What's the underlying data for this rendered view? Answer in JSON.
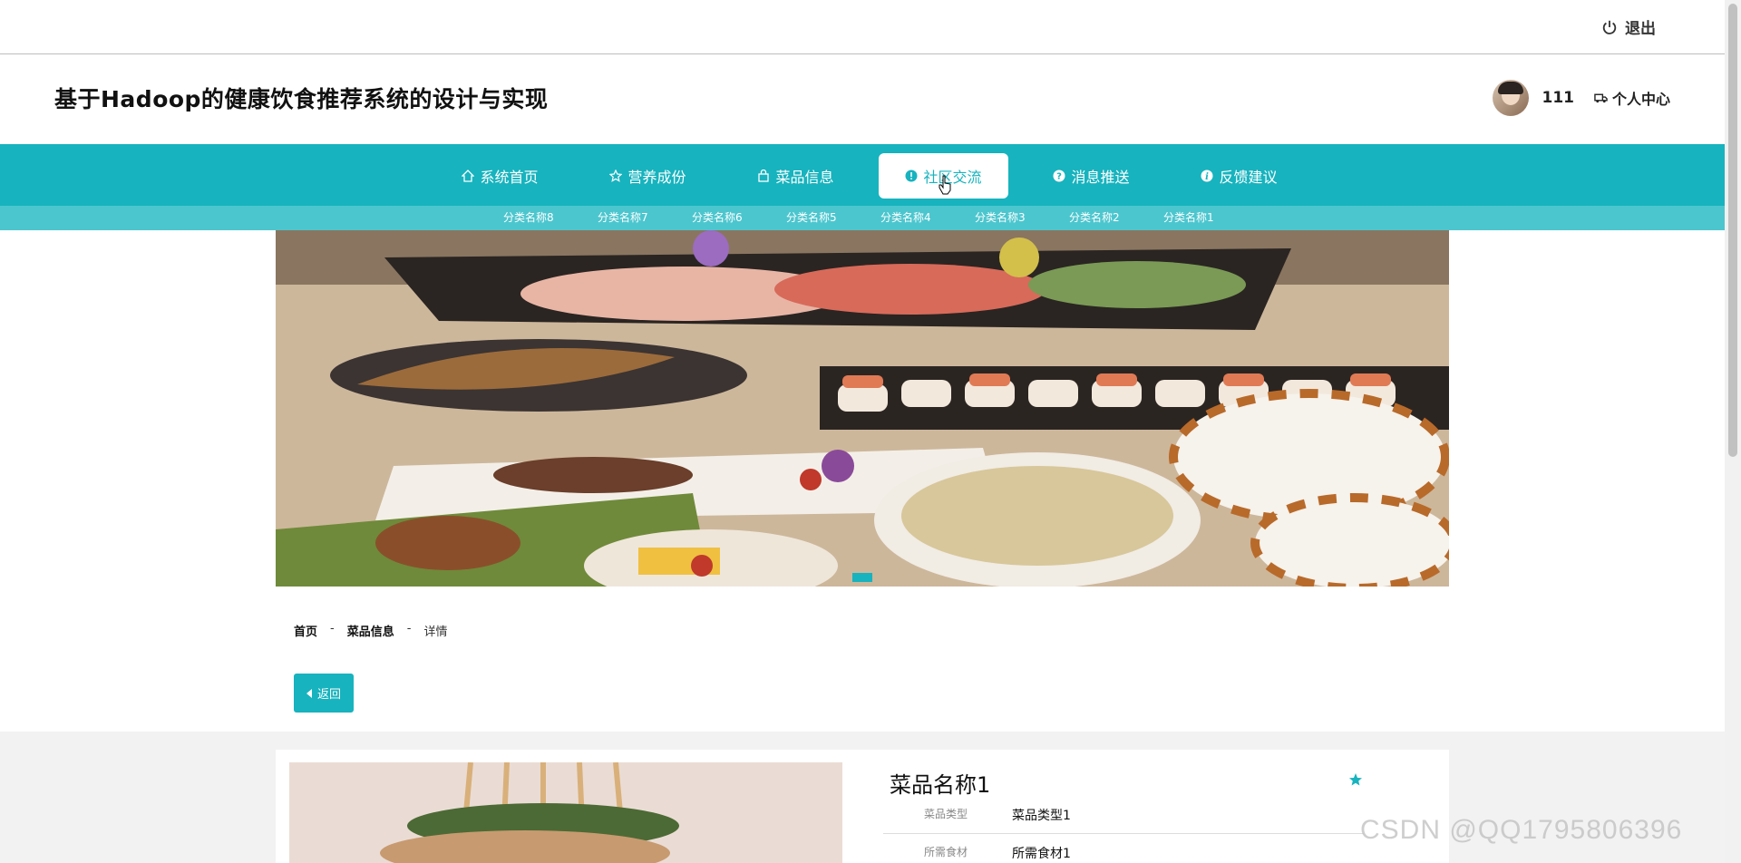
{
  "topbar": {
    "logout_label": "退出"
  },
  "header": {
    "site_title": "基于Hadoop的健康饮食推荐系统的设计与实现",
    "username": "111",
    "personal_center": "个人中心"
  },
  "nav": {
    "items": [
      {
        "label": "系统首页",
        "icon": "home-icon"
      },
      {
        "label": "营养成份",
        "icon": "star-icon"
      },
      {
        "label": "菜品信息",
        "icon": "bag-icon"
      },
      {
        "label": "社区交流",
        "icon": "info-icon",
        "active": true
      },
      {
        "label": "消息推送",
        "icon": "question-icon"
      },
      {
        "label": "反馈建议",
        "icon": "info-icon"
      }
    ],
    "sub_items": [
      "分类名称8",
      "分类名称7",
      "分类名称6",
      "分类名称5",
      "分类名称4",
      "分类名称3",
      "分类名称2",
      "分类名称1"
    ]
  },
  "breadcrumb": {
    "home": "首页",
    "sep": "-",
    "section": "菜品信息",
    "current": "详情"
  },
  "back_label": "返回",
  "dish": {
    "name": "菜品名称1",
    "rows": [
      {
        "key": "菜品类型",
        "value": "菜品类型1"
      },
      {
        "key": "所需食材",
        "value": "所需食材1"
      }
    ]
  },
  "watermark": "CSDN @QQ1795806396",
  "colors": {
    "accent": "#17b3be",
    "subnav": "#4cc6ce"
  }
}
